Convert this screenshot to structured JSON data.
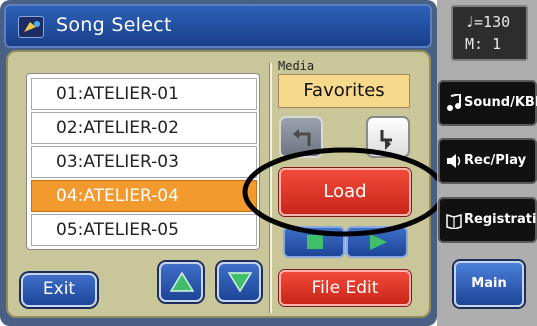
{
  "header": {
    "title": "Song Select"
  },
  "songs": [
    {
      "label": "01:ATELIER-01",
      "selected": false
    },
    {
      "label": "02:ATELIER-02",
      "selected": false
    },
    {
      "label": "03:ATELIER-03",
      "selected": false
    },
    {
      "label": "04:ATELIER-04",
      "selected": true
    },
    {
      "label": "05:ATELIER-05",
      "selected": false
    }
  ],
  "media": {
    "label": "Media",
    "value": "Favorites"
  },
  "buttons": {
    "exit": "Exit",
    "load": "Load",
    "file_edit": "File Edit"
  },
  "icons": {
    "scroll_up": "up-triangle",
    "scroll_down": "down-triangle",
    "folder_up": "folder-up-arrow",
    "folder_down": "folder-down-arrow",
    "stop": "square",
    "play": "play-triangle"
  },
  "tempo": {
    "line1": "♩=130",
    "line2": "M:   1"
  },
  "side_menu": {
    "sound": "Sound/KBD",
    "rec_play": "Rec/Play",
    "registration": "Registration",
    "main": "Main"
  },
  "colors": {
    "selected_row": "#f29a2e",
    "accent_red": "#e0372a",
    "accent_blue": "#1c4597",
    "media_yellow": "#f7d98c",
    "arrow_green": "#3fbf6a"
  }
}
